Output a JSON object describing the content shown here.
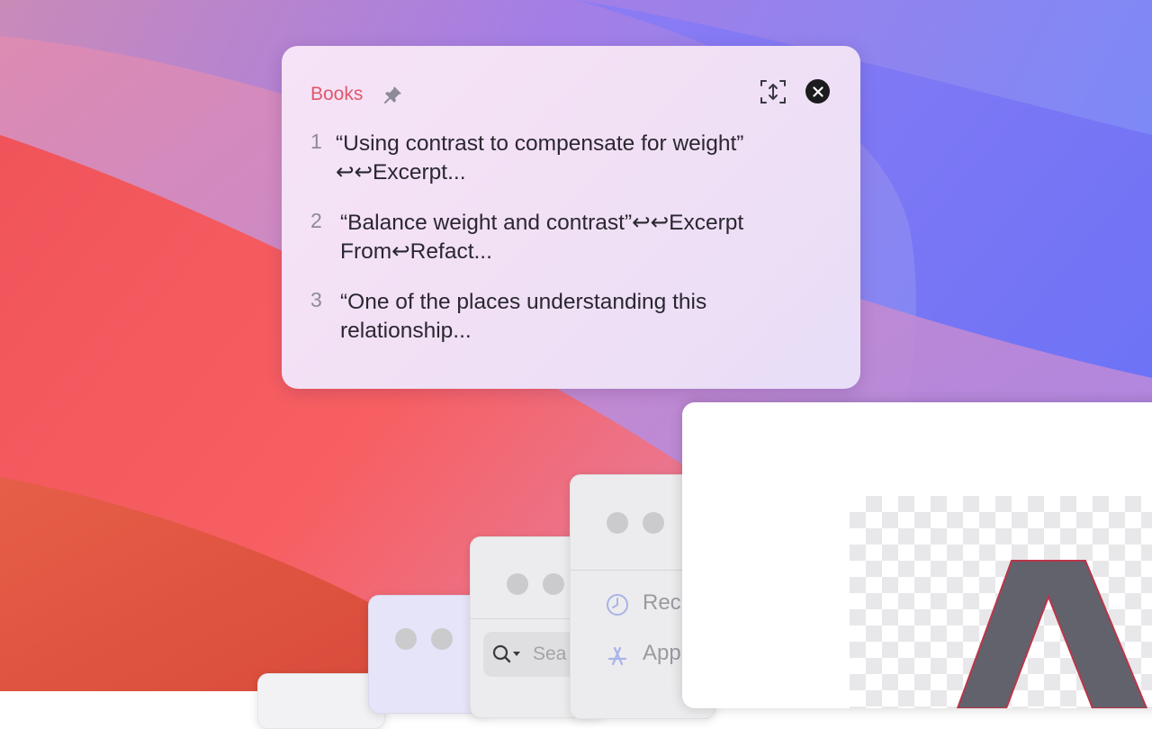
{
  "clipboard": {
    "title": "Books",
    "items": [
      {
        "num": "1",
        "text": "“Using contrast to compensate for weight”\n↩↩Excerpt..."
      },
      {
        "num": "2",
        "text": "“Balance weight and contrast”↩↩Excerpt\nFrom↩Refact..."
      },
      {
        "num": "3",
        "text": "“One of the places understanding this\nrelationship..."
      }
    ]
  },
  "icons": {
    "pin": "pin-icon",
    "expand": "expand-window-icon",
    "close": "close-icon",
    "search": "search-icon",
    "recents": "clock-icon",
    "applications": "app-store-icon"
  },
  "background_windows": {
    "search_placeholder": "Sea",
    "sidebar": [
      {
        "label": "Rec"
      },
      {
        "label": "App"
      }
    ]
  },
  "colors": {
    "title_accent": "#e0566a",
    "popover_bg": "#f3e1f6",
    "close_button": "#1c1c1e"
  }
}
